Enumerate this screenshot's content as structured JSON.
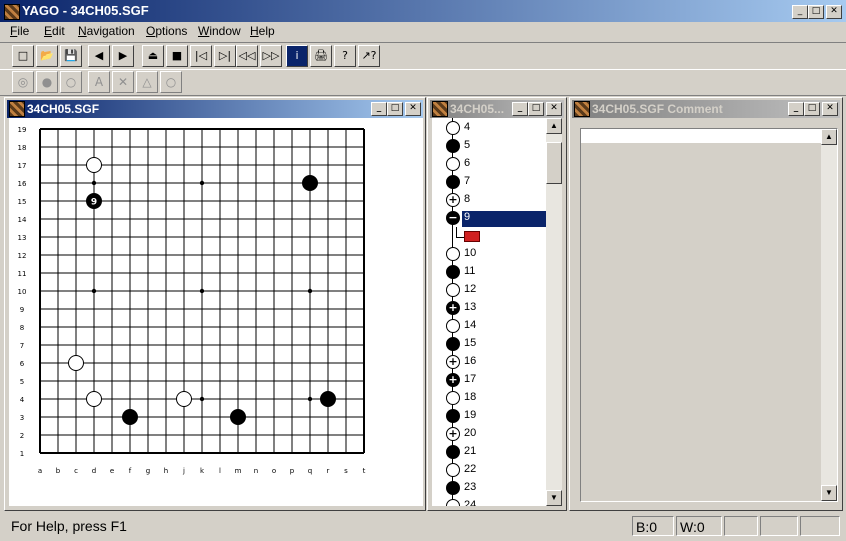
{
  "app": {
    "title": "YAGO - 34CH05.SGF"
  },
  "menu": [
    {
      "label": "File",
      "key": "F",
      "rest": "ile"
    },
    {
      "label": "Edit",
      "key": "E",
      "rest": "dit"
    },
    {
      "label": "Navigation",
      "key": "N",
      "rest": "avigation"
    },
    {
      "label": "Options",
      "key": "O",
      "rest": "ptions"
    },
    {
      "label": "Window",
      "key": "W",
      "rest": "indow"
    },
    {
      "label": "Help",
      "key": "H",
      "rest": "elp"
    }
  ],
  "toolbar": {
    "icons": [
      "new-file-icon",
      "open-folder-icon",
      "save-icon",
      "prev-move-icon",
      "next-move-icon",
      "eject-icon",
      "stop-icon",
      "first-move-icon",
      "last-move-icon",
      "rewind-icon",
      "fast-forward-icon",
      "info-icon",
      "print-icon",
      "help-icon",
      "context-help-icon"
    ],
    "glyphs": [
      "□",
      "📂",
      "💾",
      "◀",
      "▶",
      "⏏",
      "■",
      "|◁",
      "▷|",
      "◁◁",
      "▷▷",
      "i",
      "🖨",
      "?",
      "↗?"
    ],
    "edit_icons": [
      "add-mixed-stones-icon",
      "add-black-stone-icon",
      "add-white-stone-icon",
      "label-letter-icon",
      "mark-cross-icon",
      "mark-triangle-icon",
      "mark-circle-icon"
    ],
    "edit_glyphs": [
      "◎",
      "●",
      "○",
      "A",
      "✕",
      "△",
      "○"
    ]
  },
  "board_window": {
    "title": "34CH05.SGF"
  },
  "board": {
    "size": 19,
    "col_labels": [
      "a",
      "b",
      "c",
      "d",
      "e",
      "f",
      "g",
      "h",
      "j",
      "k",
      "l",
      "m",
      "n",
      "o",
      "p",
      "q",
      "r",
      "s",
      "t"
    ],
    "row_labels": [
      "19",
      "18",
      "17",
      "16",
      "15",
      "14",
      "13",
      "12",
      "11",
      "10",
      "9",
      "8",
      "7",
      "6",
      "5",
      "4",
      "3",
      "2",
      "1"
    ],
    "hoshi": [
      [
        3,
        3
      ],
      [
        9,
        3
      ],
      [
        15,
        3
      ],
      [
        3,
        9
      ],
      [
        9,
        9
      ],
      [
        15,
        9
      ],
      [
        3,
        15
      ],
      [
        9,
        15
      ],
      [
        15,
        15
      ]
    ],
    "stones": [
      {
        "c": 3,
        "r": 2,
        "color": "white"
      },
      {
        "c": 3,
        "r": 4,
        "color": "black",
        "label": "9"
      },
      {
        "c": 15,
        "r": 3,
        "color": "black"
      },
      {
        "c": 2,
        "r": 13,
        "color": "white"
      },
      {
        "c": 3,
        "r": 15,
        "color": "white"
      },
      {
        "c": 8,
        "r": 15,
        "color": "white"
      },
      {
        "c": 16,
        "r": 15,
        "color": "black"
      },
      {
        "c": 5,
        "r": 16,
        "color": "black"
      },
      {
        "c": 11,
        "r": 16,
        "color": "black"
      }
    ]
  },
  "tree_window": {
    "title": "34CH05..."
  },
  "tree": {
    "nodes": [
      {
        "label": "4",
        "color": "w",
        "mark": ""
      },
      {
        "label": "5",
        "color": "b",
        "mark": ""
      },
      {
        "label": "6",
        "color": "w",
        "mark": ""
      },
      {
        "label": "7",
        "color": "b",
        "mark": ""
      },
      {
        "label": "8",
        "color": "w",
        "mark": "+"
      },
      {
        "label": "9",
        "color": "b",
        "mark": "−",
        "selected": true
      },
      {
        "label": "",
        "color": "",
        "mark": "folder"
      },
      {
        "label": "10",
        "color": "w",
        "mark": ""
      },
      {
        "label": "11",
        "color": "b",
        "mark": ""
      },
      {
        "label": "12",
        "color": "w",
        "mark": ""
      },
      {
        "label": "13",
        "color": "b",
        "mark": "+"
      },
      {
        "label": "14",
        "color": "w",
        "mark": ""
      },
      {
        "label": "15",
        "color": "b",
        "mark": ""
      },
      {
        "label": "16",
        "color": "w",
        "mark": "+"
      },
      {
        "label": "17",
        "color": "b",
        "mark": "+"
      },
      {
        "label": "18",
        "color": "w",
        "mark": ""
      },
      {
        "label": "19",
        "color": "b",
        "mark": ""
      },
      {
        "label": "20",
        "color": "w",
        "mark": "+"
      },
      {
        "label": "21",
        "color": "b",
        "mark": ""
      },
      {
        "label": "22",
        "color": "w",
        "mark": ""
      },
      {
        "label": "23",
        "color": "b",
        "mark": ""
      },
      {
        "label": "24",
        "color": "w",
        "mark": ""
      }
    ]
  },
  "comment_window": {
    "title": "34CH05.SGF Comment",
    "text": ""
  },
  "status": {
    "help": "For Help, press F1",
    "black": "B:0",
    "white": "W:0"
  },
  "colors": {
    "title_active": "#0a246a",
    "selection": "#0a246a",
    "board_bg": "#ffffff"
  }
}
